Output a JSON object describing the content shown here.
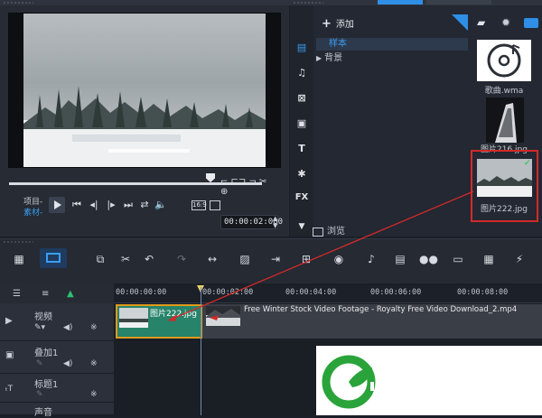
{
  "player": {
    "project_label": "项目-",
    "clip_label": "素材-",
    "aspect": "16:9",
    "timecode": "00:00:02:000"
  },
  "library": {
    "add_label": "添加",
    "folders": [
      {
        "label": "样本",
        "selected": true
      },
      {
        "label": "背景",
        "selected": false
      }
    ],
    "browse_label": "浏览",
    "side_fx": "FX",
    "side_text": "T",
    "thumbnails": [
      {
        "label": "歌曲.wma",
        "kind": "audio",
        "selected": false
      },
      {
        "label": "图片216.jpg",
        "kind": "image",
        "selected": false
      },
      {
        "label": "图片222.jpg",
        "kind": "image",
        "selected": true
      }
    ]
  },
  "timeline": {
    "ruler": [
      "00:00:00:00",
      "00:00:02:00",
      "00:00:04:00",
      "00:00:06:00",
      "00:00:08:00"
    ],
    "tracks": [
      {
        "label": "视频"
      },
      {
        "label": "叠加1"
      },
      {
        "label": "标题1"
      },
      {
        "label": "声音"
      }
    ],
    "image_clip_label": "图片222.jpg",
    "video_clip_label": "Free Winter Stock Video Footage - Royalty Free Video Download_2.mp4"
  },
  "colors": {
    "accent_blue": "#3b9df2",
    "selection_red": "#d32a2a",
    "clip_green": "#27836a",
    "clip_border": "#e09a1c",
    "logo_green": "#2aa33a"
  }
}
